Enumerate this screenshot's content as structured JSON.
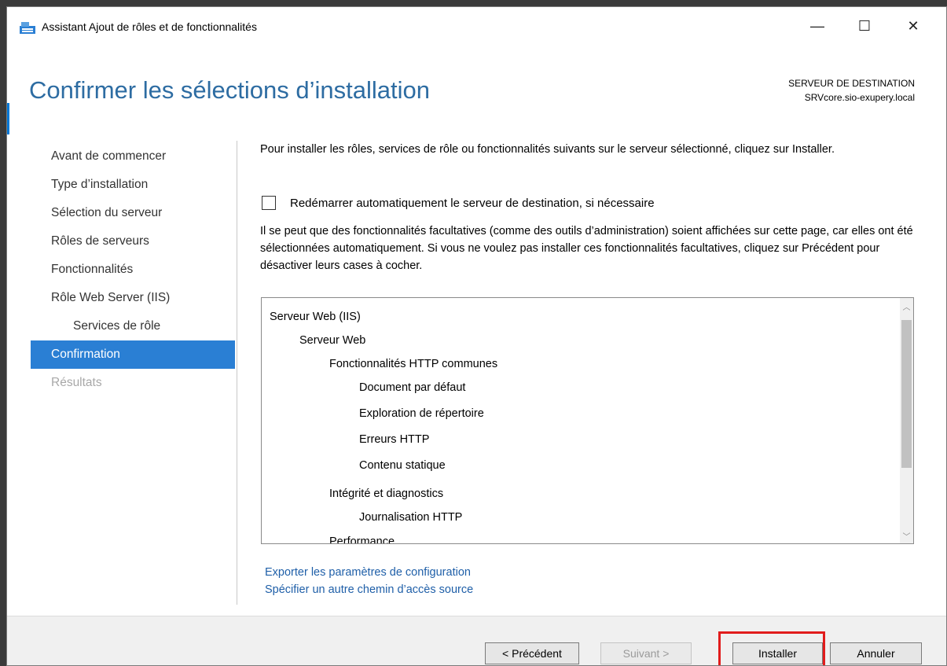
{
  "window": {
    "title": "Assistant Ajout de rôles et de fonctionnalités",
    "minimize_glyph": "—",
    "maximize_glyph": "☐",
    "close_glyph": "✕"
  },
  "header": {
    "page_title": "Confirmer les sélections d’installation",
    "destination_label": "SERVEUR DE DESTINATION",
    "destination_value": "SRVcore.sio-exupery.local"
  },
  "nav": {
    "items": [
      {
        "label": "Avant de commencer"
      },
      {
        "label": "Type d’installation"
      },
      {
        "label": "Sélection du serveur"
      },
      {
        "label": "Rôles de serveurs"
      },
      {
        "label": "Fonctionnalités"
      },
      {
        "label": "Rôle Web Server (IIS)"
      },
      {
        "label": "Services de rôle"
      },
      {
        "label": "Confirmation"
      },
      {
        "label": "Résultats"
      }
    ]
  },
  "main": {
    "intro": "Pour installer les rôles, services de rôle ou fonctionnalités suivants sur le serveur sélectionné, cliquez sur Installer.",
    "restart_label": "Redémarrer automatiquement le serveur de destination, si nécessaire",
    "restart_checked": false,
    "note": "Il se peut que des fonctionnalités facultatives (comme des outils d’administration) soient affichées sur cette page, car elles ont été sélectionnées automatiquement. Si vous ne voulez pas installer ces fonctionnalités facultatives, cliquez sur Précédent pour désactiver leurs cases à cocher.",
    "tree": [
      {
        "label": "Serveur Web (IIS)",
        "level": 0
      },
      {
        "label": "Serveur Web",
        "level": 1
      },
      {
        "label": "Fonctionnalités HTTP communes",
        "level": 2
      },
      {
        "label": "Document par défaut",
        "level": 3
      },
      {
        "label": "Exploration de répertoire",
        "level": 3
      },
      {
        "label": "Erreurs HTTP",
        "level": 3
      },
      {
        "label": "Contenu statique",
        "level": 3
      },
      {
        "label": "Intégrité et diagnostics",
        "level": 2
      },
      {
        "label": "Journalisation HTTP",
        "level": 3
      },
      {
        "label": "Performance",
        "level": 2
      }
    ],
    "scroll_up_glyph": "︿",
    "scroll_down_glyph": "﹀",
    "links": {
      "export": "Exporter les paramètres de configuration",
      "source_path": "Spécifier un autre chemin d’accès source"
    }
  },
  "footer": {
    "prev_label": "< Précédent",
    "next_label": "Suivant >",
    "install_label": "Installer",
    "cancel_label": "Annuler"
  },
  "colors": {
    "accent": "#2a7fd4",
    "title": "#2d6ca2",
    "link": "#1f5fa8",
    "highlight": "#e11c1c"
  }
}
